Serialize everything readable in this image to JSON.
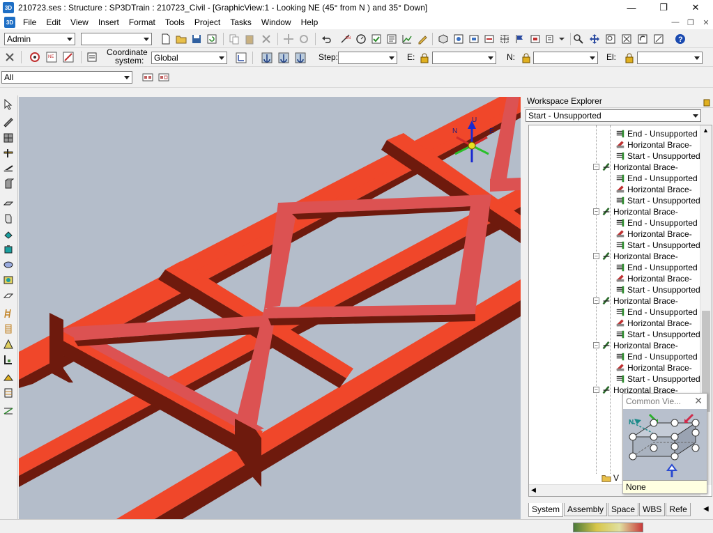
{
  "window": {
    "title": "210723.ses : Structure : SP3DTrain : 210723_Civil - [GraphicView:1 - Looking NE (45° from N ) and 35° Down]",
    "icon_text": "3D",
    "controls": {
      "minimize": "—",
      "maximize": "❐",
      "close": "✕"
    }
  },
  "menu": {
    "icon_text": "3D",
    "items": [
      "File",
      "Edit",
      "View",
      "Insert",
      "Format",
      "Tools",
      "Project",
      "Tasks",
      "Window",
      "Help"
    ]
  },
  "toolbar1": {
    "permission_group": "Admin",
    "second_combo": ""
  },
  "toolbar2": {
    "coordinate_label_line1": "Coordinate",
    "coordinate_label_line2": "system:",
    "coordinate_system": "Global",
    "step_label": "Step:",
    "step_value": "",
    "e_label": "E:",
    "e_value": "",
    "n_label": "N:",
    "n_value": "",
    "el_label": "El:",
    "el_value": ""
  },
  "toolbar3": {
    "filter": "All"
  },
  "viewport": {
    "background_color": "#b4bdca",
    "member_color_bright": "#f0472a",
    "member_color_dark": "#6e1a0d",
    "brace_color": "#dc5252",
    "axis_labels": {
      "up": "U",
      "north": "N",
      "east": "E"
    }
  },
  "explorer": {
    "title": "Workspace Explorer",
    "filter": "Start - Unsupported",
    "tree": [
      {
        "label": "End - Unsupported",
        "level": 2,
        "icon": "end-connection-icon"
      },
      {
        "label": "Horizontal Brace-",
        "level": 2,
        "icon": "brace-part-icon"
      },
      {
        "label": "Start - Unsupported",
        "level": 2,
        "icon": "start-connection-icon"
      },
      {
        "label": "Horizontal Brace-",
        "level": 1,
        "icon": "member-system-icon",
        "expanded": true
      },
      {
        "label": "End - Unsupported",
        "level": 2,
        "icon": "end-connection-icon"
      },
      {
        "label": "Horizontal Brace-",
        "level": 2,
        "icon": "brace-part-icon"
      },
      {
        "label": "Start - Unsupported",
        "level": 2,
        "icon": "start-connection-icon"
      },
      {
        "label": "Horizontal Brace-",
        "level": 1,
        "icon": "member-system-icon",
        "expanded": true
      },
      {
        "label": "End - Unsupported",
        "level": 2,
        "icon": "end-connection-icon"
      },
      {
        "label": "Horizontal Brace-",
        "level": 2,
        "icon": "brace-part-icon"
      },
      {
        "label": "Start - Unsupported",
        "level": 2,
        "icon": "start-connection-icon"
      },
      {
        "label": "Horizontal Brace-",
        "level": 1,
        "icon": "member-system-icon",
        "expanded": true
      },
      {
        "label": "End - Unsupported",
        "level": 2,
        "icon": "end-connection-icon"
      },
      {
        "label": "Horizontal Brace-",
        "level": 2,
        "icon": "brace-part-icon"
      },
      {
        "label": "Start - Unsupported",
        "level": 2,
        "icon": "start-connection-icon"
      },
      {
        "label": "Horizontal Brace-",
        "level": 1,
        "icon": "member-system-icon",
        "expanded": true
      },
      {
        "label": "End - Unsupported",
        "level": 2,
        "icon": "end-connection-icon"
      },
      {
        "label": "Horizontal Brace-",
        "level": 2,
        "icon": "brace-part-icon"
      },
      {
        "label": "Start - Unsupported",
        "level": 2,
        "icon": "start-connection-icon"
      },
      {
        "label": "Horizontal Brace-",
        "level": 1,
        "icon": "member-system-icon",
        "expanded": true
      },
      {
        "label": "End - Unsupported",
        "level": 2,
        "icon": "end-connection-icon"
      },
      {
        "label": "Horizontal Brace-",
        "level": 2,
        "icon": "brace-part-icon"
      },
      {
        "label": "Start - Unsupported",
        "level": 2,
        "icon": "start-connection-icon"
      },
      {
        "label": "Horizontal Brace-",
        "level": 1,
        "icon": "member-system-icon",
        "expanded": true
      }
    ],
    "bottom_item": "V",
    "tabs": [
      "System",
      "Assembly",
      "Space",
      "WBS",
      "Refe"
    ],
    "active_tab": "System"
  },
  "common_views": {
    "title": "Common Vie...",
    "close": "✕",
    "north_label": "N",
    "status": "None"
  }
}
